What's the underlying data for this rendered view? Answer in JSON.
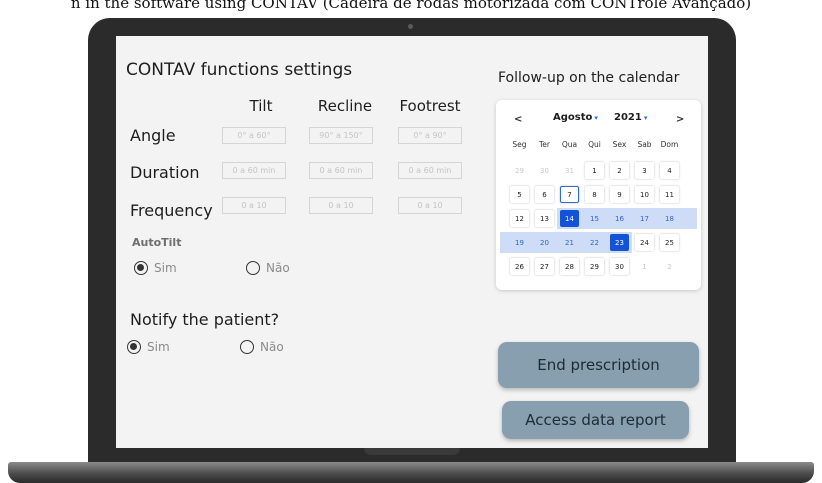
{
  "caption": "n in the software using CONTAV (Cadeira de rodas motorizada com CONTrole Avançado)",
  "settings": {
    "title": "CONTAV functions settings",
    "columns": [
      "Tilt",
      "Recline",
      "Footrest"
    ],
    "rows": [
      {
        "label": "Angle",
        "placeholders": [
          "0° a 60°",
          "90° a 150°",
          "0° a 90°"
        ]
      },
      {
        "label": "Duration",
        "placeholders": [
          "0 a 60 min",
          "0 a 60 min",
          "0 a 60 min"
        ]
      },
      {
        "label": "Frequency",
        "placeholders": [
          "0 a 10",
          "0 a 10",
          "0 a 10"
        ]
      }
    ],
    "autotilt": {
      "label": "AutoTilt",
      "yes": "Sim",
      "no": "Não",
      "selected": "yes"
    },
    "notify": {
      "label": "Notify the patient?",
      "yes": "Sim",
      "no": "Não",
      "selected": "yes"
    }
  },
  "calendar": {
    "title": "Follow-up on the calendar",
    "prev": "<",
    "next": ">",
    "month": "Agosto",
    "year": "2021",
    "weekdays": [
      "Seg",
      "Ter",
      "Qua",
      "Qui",
      "Sex",
      "Sab",
      "Dom"
    ],
    "weeks": [
      [
        "29",
        "30",
        "31",
        "1",
        "2",
        "3",
        "4"
      ],
      [
        "5",
        "6",
        "7",
        "8",
        "9",
        "10",
        "11"
      ],
      [
        "12",
        "13",
        "14",
        "15",
        "16",
        "17",
        "18"
      ],
      [
        "19",
        "20",
        "21",
        "22",
        "23",
        "24",
        "25"
      ],
      [
        "26",
        "27",
        "28",
        "29",
        "30",
        "1",
        "2"
      ]
    ],
    "today": "7",
    "range_start": "14",
    "range_end": "23",
    "accent": "#1553d6",
    "range_color": "#cfdcf7"
  },
  "buttons": {
    "end": "End prescription",
    "report": "Access data report",
    "color": "#889faf"
  }
}
